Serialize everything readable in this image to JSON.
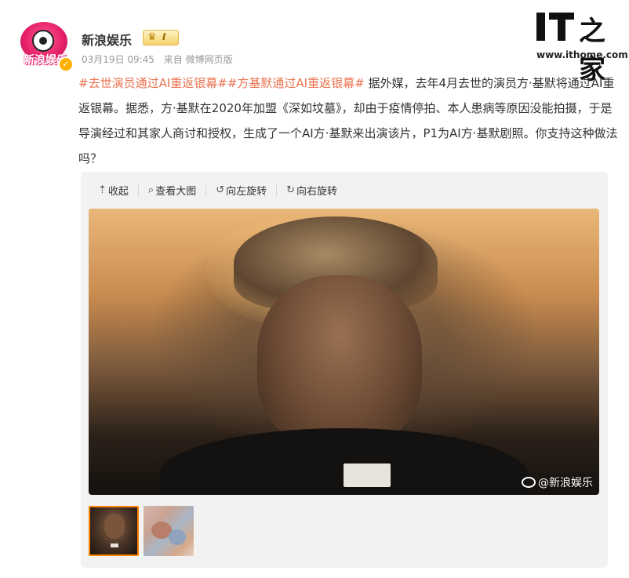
{
  "user": {
    "name": "新浪娱乐",
    "avatar_text": "新浪娱乐",
    "badge_level": "I",
    "date": "03月19日 09:45",
    "source": "来自 微博网页版"
  },
  "ithome": {
    "logo_text": "IT之家",
    "url": "www.ithome.com"
  },
  "post": {
    "hashtag1": "#去世演员通过AI重返银幕#",
    "hashtag2": "#方基默通过AI重返银幕#",
    "body": "据外媒，去年4月去世的演员方·基默将通过AI重返银幕。据悉，方·基默在2020年加盟《深如坟墓》，却由于疫情停拍、本人患病等原因没能拍摄，于是导演经过和其家人商讨和授权，生成了一个AI方·基默来出演该片，P1为AI方·基默剧照。你支持这种做法吗？"
  },
  "toolbar": {
    "collapse_label": "收起",
    "view_large_label": "查看大图",
    "rotate_left_label": "向左旋转",
    "rotate_right_label": "向右旋转"
  },
  "image": {
    "watermark": "@新浪娱乐"
  },
  "colors": {
    "hashtag": "#eb7350",
    "thumb_active_border": "#ff8200",
    "card_bg": "#f2f2f2"
  }
}
